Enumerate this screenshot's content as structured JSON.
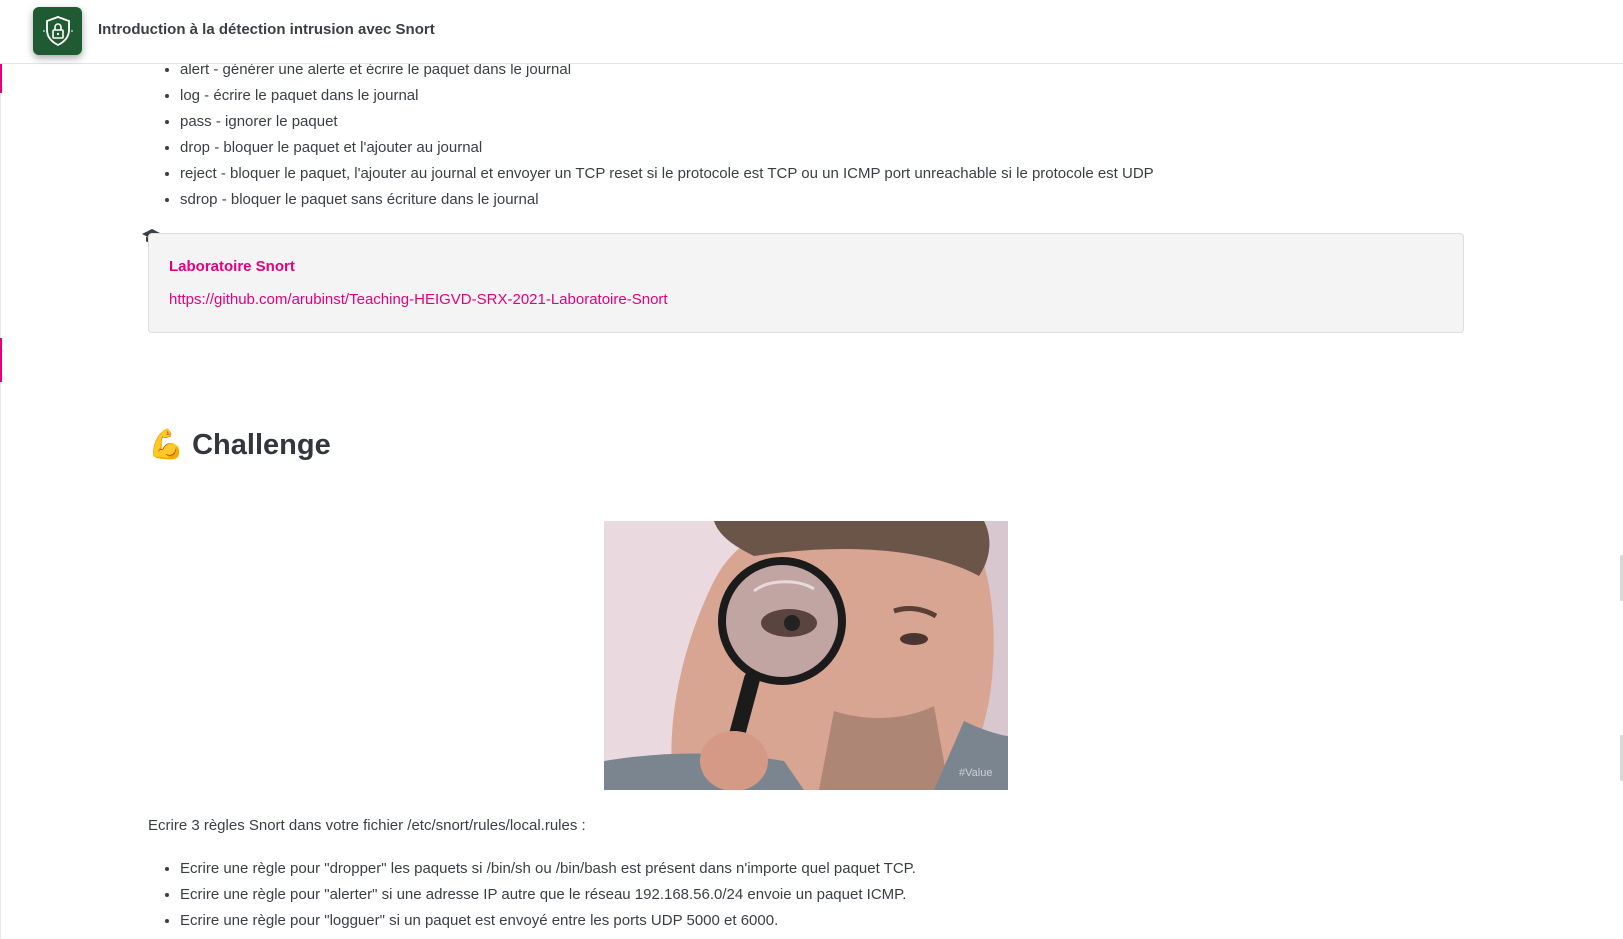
{
  "header": {
    "course_title": "Introduction à la détection intrusion avec Snort"
  },
  "actions_list": [
    "alert - générer une alerte et écrire le paquet dans le journal",
    "log - écrire le paquet dans le journal",
    "pass - ignorer le paquet",
    "drop - bloquer le paquet et l'ajouter au journal",
    "reject - bloquer le paquet, l'ajouter au journal et envoyer un TCP reset si le protocole est TCP ou un ICMP port unreachable si le protocole est UDP",
    "sdrop - bloquer le paquet sans écriture dans le journal"
  ],
  "note": {
    "title": "Laboratoire Snort",
    "link": "https://github.com/arubinst/Teaching-HEIGVD-SRX-2021-Laboratoire-Snort"
  },
  "challenge": {
    "emoji": "💪",
    "heading": "Challenge"
  },
  "gif": {
    "watermark": "#Value"
  },
  "task": {
    "intro": "Ecrire 3 règles Snort dans votre fichier /etc/snort/rules/local.rules :",
    "items": [
      "Ecrire une règle pour \"dropper\" les paquets si /bin/sh ou /bin/bash est présent dans n'importe quel paquet TCP.",
      "Ecrire une règle pour \"alerter\" si une adresse IP autre que le réseau 192.168.56.0/24 envoie un paquet ICMP.",
      "Ecrire une règle pour \"logguer\" si un paquet est envoyé entre les ports UDP 5000 et 6000."
    ]
  },
  "colors": {
    "accent": "#e5007d",
    "logo_bg": "#1f5a33",
    "text": "#3b3f45"
  }
}
